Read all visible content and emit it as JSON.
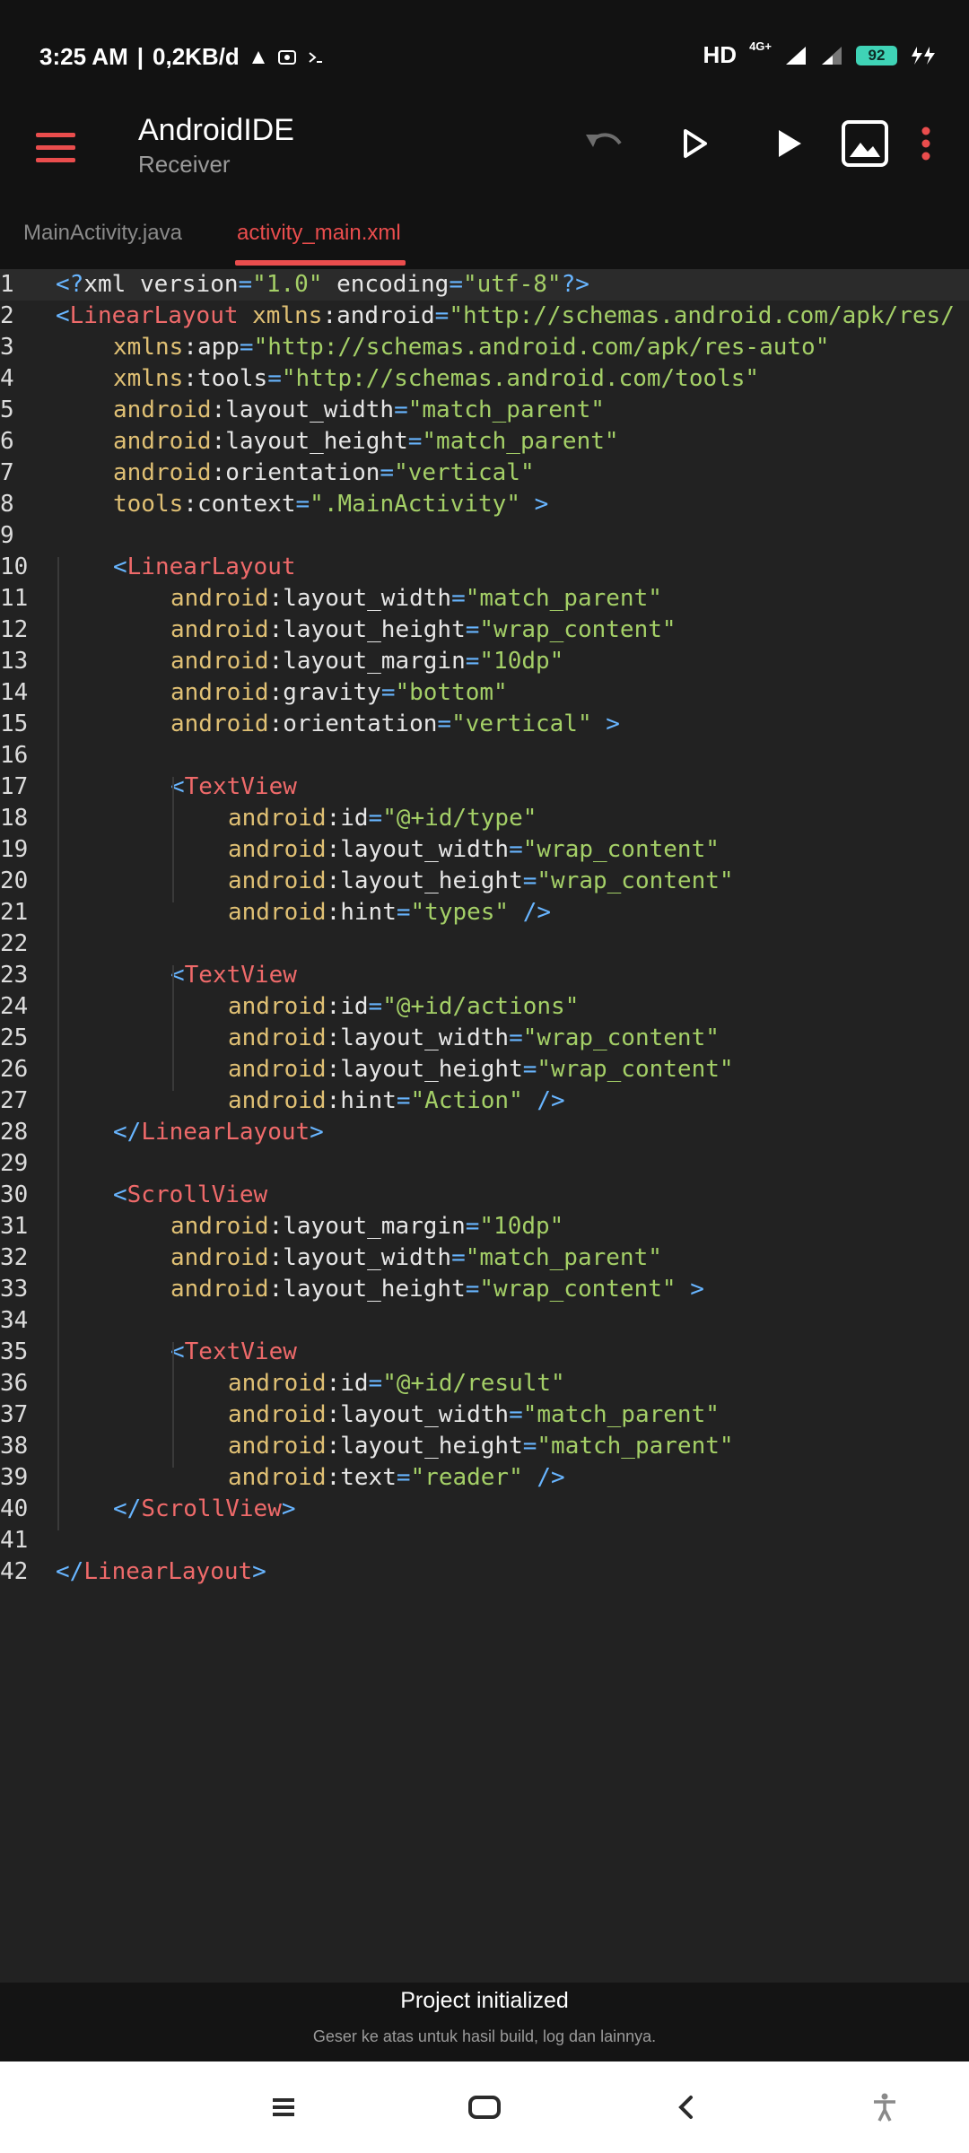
{
  "status_bar": {
    "time": "3:25 AM",
    "data_rate": "0,2KB/d",
    "network": "4G+",
    "battery": "92"
  },
  "app_bar": {
    "title": "AndroidIDE",
    "subtitle": "Receiver",
    "icons": [
      "menu-icon",
      "undo-icon",
      "play-outline-icon",
      "run-icon",
      "image-icon",
      "more-vert-icon"
    ]
  },
  "tabs": [
    {
      "label": "MainActivity.java",
      "active": false
    },
    {
      "label": "activity_main.xml",
      "active": true
    }
  ],
  "editor": {
    "lines": [
      {
        "n": "1",
        "indent": 0,
        "tokens": [
          [
            "br",
            "<?"
          ],
          [
            "plain",
            "xml "
          ],
          [
            "plain",
            "version"
          ],
          [
            "eq",
            "="
          ],
          [
            "val",
            "\"1.0\""
          ],
          [
            "plain",
            " encoding"
          ],
          [
            "eq",
            "="
          ],
          [
            "val",
            "\"utf-8\""
          ],
          [
            "br",
            "?>"
          ]
        ]
      },
      {
        "n": "2",
        "indent": 0,
        "tokens": [
          [
            "br",
            "<"
          ],
          [
            "tag",
            "LinearLayout"
          ],
          [
            "plain",
            " "
          ],
          [
            "ns",
            "xmlns"
          ],
          [
            "colon",
            ":"
          ],
          [
            "attrname",
            "android"
          ],
          [
            "eq",
            "="
          ],
          [
            "val",
            "\"http://schemas.android.com/apk/res/"
          ]
        ]
      },
      {
        "n": "3",
        "indent": 1,
        "tokens": [
          [
            "ns",
            "xmlns"
          ],
          [
            "colon",
            ":"
          ],
          [
            "attrname",
            "app"
          ],
          [
            "eq",
            "="
          ],
          [
            "val",
            "\"http://schemas.android.com/apk/res-auto\""
          ]
        ]
      },
      {
        "n": "4",
        "indent": 1,
        "tokens": [
          [
            "ns",
            "xmlns"
          ],
          [
            "colon",
            ":"
          ],
          [
            "attrname",
            "tools"
          ],
          [
            "eq",
            "="
          ],
          [
            "val",
            "\"http://schemas.android.com/tools\""
          ]
        ]
      },
      {
        "n": "5",
        "indent": 1,
        "tokens": [
          [
            "ns",
            "android"
          ],
          [
            "colon",
            ":"
          ],
          [
            "attrname",
            "layout_width"
          ],
          [
            "eq",
            "="
          ],
          [
            "val",
            "\"match_parent\""
          ]
        ]
      },
      {
        "n": "6",
        "indent": 1,
        "tokens": [
          [
            "ns",
            "android"
          ],
          [
            "colon",
            ":"
          ],
          [
            "attrname",
            "layout_height"
          ],
          [
            "eq",
            "="
          ],
          [
            "val",
            "\"match_parent\""
          ]
        ]
      },
      {
        "n": "7",
        "indent": 1,
        "tokens": [
          [
            "ns",
            "android"
          ],
          [
            "colon",
            ":"
          ],
          [
            "attrname",
            "orientation"
          ],
          [
            "eq",
            "="
          ],
          [
            "val",
            "\"vertical\""
          ]
        ]
      },
      {
        "n": "8",
        "indent": 1,
        "tokens": [
          [
            "ns",
            "tools"
          ],
          [
            "colon",
            ":"
          ],
          [
            "attrname",
            "context"
          ],
          [
            "eq",
            "="
          ],
          [
            "val",
            "\".MainActivity\""
          ],
          [
            "plain",
            " "
          ],
          [
            "br",
            ">"
          ]
        ]
      },
      {
        "n": "9",
        "indent": 0,
        "tokens": []
      },
      {
        "n": "10",
        "indent": 1,
        "tokens": [
          [
            "br",
            "<"
          ],
          [
            "tag",
            "LinearLayout"
          ]
        ]
      },
      {
        "n": "11",
        "indent": 2,
        "tokens": [
          [
            "ns",
            "android"
          ],
          [
            "colon",
            ":"
          ],
          [
            "attrname",
            "layout_width"
          ],
          [
            "eq",
            "="
          ],
          [
            "val",
            "\"match_parent\""
          ]
        ]
      },
      {
        "n": "12",
        "indent": 2,
        "tokens": [
          [
            "ns",
            "android"
          ],
          [
            "colon",
            ":"
          ],
          [
            "attrname",
            "layout_height"
          ],
          [
            "eq",
            "="
          ],
          [
            "val",
            "\"wrap_content\""
          ]
        ]
      },
      {
        "n": "13",
        "indent": 2,
        "tokens": [
          [
            "ns",
            "android"
          ],
          [
            "colon",
            ":"
          ],
          [
            "attrname",
            "layout_margin"
          ],
          [
            "eq",
            "="
          ],
          [
            "val",
            "\"10dp\""
          ]
        ]
      },
      {
        "n": "14",
        "indent": 2,
        "tokens": [
          [
            "ns",
            "android"
          ],
          [
            "colon",
            ":"
          ],
          [
            "attrname",
            "gravity"
          ],
          [
            "eq",
            "="
          ],
          [
            "val",
            "\"bottom\""
          ]
        ]
      },
      {
        "n": "15",
        "indent": 2,
        "tokens": [
          [
            "ns",
            "android"
          ],
          [
            "colon",
            ":"
          ],
          [
            "attrname",
            "orientation"
          ],
          [
            "eq",
            "="
          ],
          [
            "val",
            "\"vertical\""
          ],
          [
            "plain",
            " "
          ],
          [
            "br",
            ">"
          ]
        ]
      },
      {
        "n": "16",
        "indent": 0,
        "tokens": []
      },
      {
        "n": "17",
        "indent": 2,
        "tokens": [
          [
            "br",
            "<"
          ],
          [
            "tag",
            "TextView"
          ]
        ]
      },
      {
        "n": "18",
        "indent": 3,
        "tokens": [
          [
            "ns",
            "android"
          ],
          [
            "colon",
            ":"
          ],
          [
            "attrname",
            "id"
          ],
          [
            "eq",
            "="
          ],
          [
            "val",
            "\"@+id/type\""
          ]
        ]
      },
      {
        "n": "19",
        "indent": 3,
        "tokens": [
          [
            "ns",
            "android"
          ],
          [
            "colon",
            ":"
          ],
          [
            "attrname",
            "layout_width"
          ],
          [
            "eq",
            "="
          ],
          [
            "val",
            "\"wrap_content\""
          ]
        ]
      },
      {
        "n": "20",
        "indent": 3,
        "tokens": [
          [
            "ns",
            "android"
          ],
          [
            "colon",
            ":"
          ],
          [
            "attrname",
            "layout_height"
          ],
          [
            "eq",
            "="
          ],
          [
            "val",
            "\"wrap_content\""
          ]
        ]
      },
      {
        "n": "21",
        "indent": 3,
        "tokens": [
          [
            "ns",
            "android"
          ],
          [
            "colon",
            ":"
          ],
          [
            "attrname",
            "hint"
          ],
          [
            "eq",
            "="
          ],
          [
            "val",
            "\"types\""
          ],
          [
            "plain",
            " "
          ],
          [
            "br",
            "/>"
          ]
        ]
      },
      {
        "n": "22",
        "indent": 0,
        "tokens": []
      },
      {
        "n": "23",
        "indent": 2,
        "tokens": [
          [
            "br",
            "<"
          ],
          [
            "tag",
            "TextView"
          ]
        ]
      },
      {
        "n": "24",
        "indent": 3,
        "tokens": [
          [
            "ns",
            "android"
          ],
          [
            "colon",
            ":"
          ],
          [
            "attrname",
            "id"
          ],
          [
            "eq",
            "="
          ],
          [
            "val",
            "\"@+id/actions\""
          ]
        ]
      },
      {
        "n": "25",
        "indent": 3,
        "tokens": [
          [
            "ns",
            "android"
          ],
          [
            "colon",
            ":"
          ],
          [
            "attrname",
            "layout_width"
          ],
          [
            "eq",
            "="
          ],
          [
            "val",
            "\"wrap_content\""
          ]
        ]
      },
      {
        "n": "26",
        "indent": 3,
        "tokens": [
          [
            "ns",
            "android"
          ],
          [
            "colon",
            ":"
          ],
          [
            "attrname",
            "layout_height"
          ],
          [
            "eq",
            "="
          ],
          [
            "val",
            "\"wrap_content\""
          ]
        ]
      },
      {
        "n": "27",
        "indent": 3,
        "tokens": [
          [
            "ns",
            "android"
          ],
          [
            "colon",
            ":"
          ],
          [
            "attrname",
            "hint"
          ],
          [
            "eq",
            "="
          ],
          [
            "val",
            "\"Action\""
          ],
          [
            "plain",
            " "
          ],
          [
            "br",
            "/>"
          ]
        ]
      },
      {
        "n": "28",
        "indent": 1,
        "tokens": [
          [
            "br",
            "</"
          ],
          [
            "tag",
            "LinearLayout"
          ],
          [
            "br",
            ">"
          ]
        ]
      },
      {
        "n": "29",
        "indent": 0,
        "tokens": []
      },
      {
        "n": "30",
        "indent": 1,
        "tokens": [
          [
            "br",
            "<"
          ],
          [
            "tag",
            "ScrollView"
          ]
        ]
      },
      {
        "n": "31",
        "indent": 2,
        "tokens": [
          [
            "ns",
            "android"
          ],
          [
            "colon",
            ":"
          ],
          [
            "attrname",
            "layout_margin"
          ],
          [
            "eq",
            "="
          ],
          [
            "val",
            "\"10dp\""
          ]
        ]
      },
      {
        "n": "32",
        "indent": 2,
        "tokens": [
          [
            "ns",
            "android"
          ],
          [
            "colon",
            ":"
          ],
          [
            "attrname",
            "layout_width"
          ],
          [
            "eq",
            "="
          ],
          [
            "val",
            "\"match_parent\""
          ]
        ]
      },
      {
        "n": "33",
        "indent": 2,
        "tokens": [
          [
            "ns",
            "android"
          ],
          [
            "colon",
            ":"
          ],
          [
            "attrname",
            "layout_height"
          ],
          [
            "eq",
            "="
          ],
          [
            "val",
            "\"wrap_content\""
          ],
          [
            "plain",
            " "
          ],
          [
            "br",
            ">"
          ]
        ]
      },
      {
        "n": "34",
        "indent": 0,
        "tokens": []
      },
      {
        "n": "35",
        "indent": 2,
        "tokens": [
          [
            "br",
            "<"
          ],
          [
            "tag",
            "TextView"
          ]
        ]
      },
      {
        "n": "36",
        "indent": 3,
        "tokens": [
          [
            "ns",
            "android"
          ],
          [
            "colon",
            ":"
          ],
          [
            "attrname",
            "id"
          ],
          [
            "eq",
            "="
          ],
          [
            "val",
            "\"@+id/result\""
          ]
        ]
      },
      {
        "n": "37",
        "indent": 3,
        "tokens": [
          [
            "ns",
            "android"
          ],
          [
            "colon",
            ":"
          ],
          [
            "attrname",
            "layout_width"
          ],
          [
            "eq",
            "="
          ],
          [
            "val",
            "\"match_parent\""
          ]
        ]
      },
      {
        "n": "38",
        "indent": 3,
        "tokens": [
          [
            "ns",
            "android"
          ],
          [
            "colon",
            ":"
          ],
          [
            "attrname",
            "layout_height"
          ],
          [
            "eq",
            "="
          ],
          [
            "val",
            "\"match_parent\""
          ]
        ]
      },
      {
        "n": "39",
        "indent": 3,
        "tokens": [
          [
            "ns",
            "android"
          ],
          [
            "colon",
            ":"
          ],
          [
            "attrname",
            "text"
          ],
          [
            "eq",
            "="
          ],
          [
            "val",
            "\"reader\""
          ],
          [
            "plain",
            " "
          ],
          [
            "br",
            "/>"
          ]
        ]
      },
      {
        "n": "40",
        "indent": 1,
        "tokens": [
          [
            "br",
            "</"
          ],
          [
            "tag",
            "ScrollView"
          ],
          [
            "br",
            ">"
          ]
        ]
      },
      {
        "n": "41",
        "indent": 0,
        "tokens": []
      },
      {
        "n": "42",
        "indent": 0,
        "tokens": [
          [
            "br",
            "</"
          ],
          [
            "tag",
            "LinearLayout"
          ],
          [
            "br",
            ">"
          ]
        ]
      }
    ]
  },
  "bottom_panel": {
    "title": "Project initialized",
    "hint": "Geser ke atas untuk hasil build, log dan lainnya."
  },
  "nav_bar": {
    "icons": [
      "recents-icon",
      "home-icon",
      "back-icon",
      "accessibility-icon"
    ]
  },
  "colors": {
    "accent": "#ea4d4d",
    "editor_bg": "#222222",
    "tag": "#ef6a6a",
    "attr": "#f0c65c",
    "value": "#a4cf67",
    "bracket": "#68b5ff"
  }
}
